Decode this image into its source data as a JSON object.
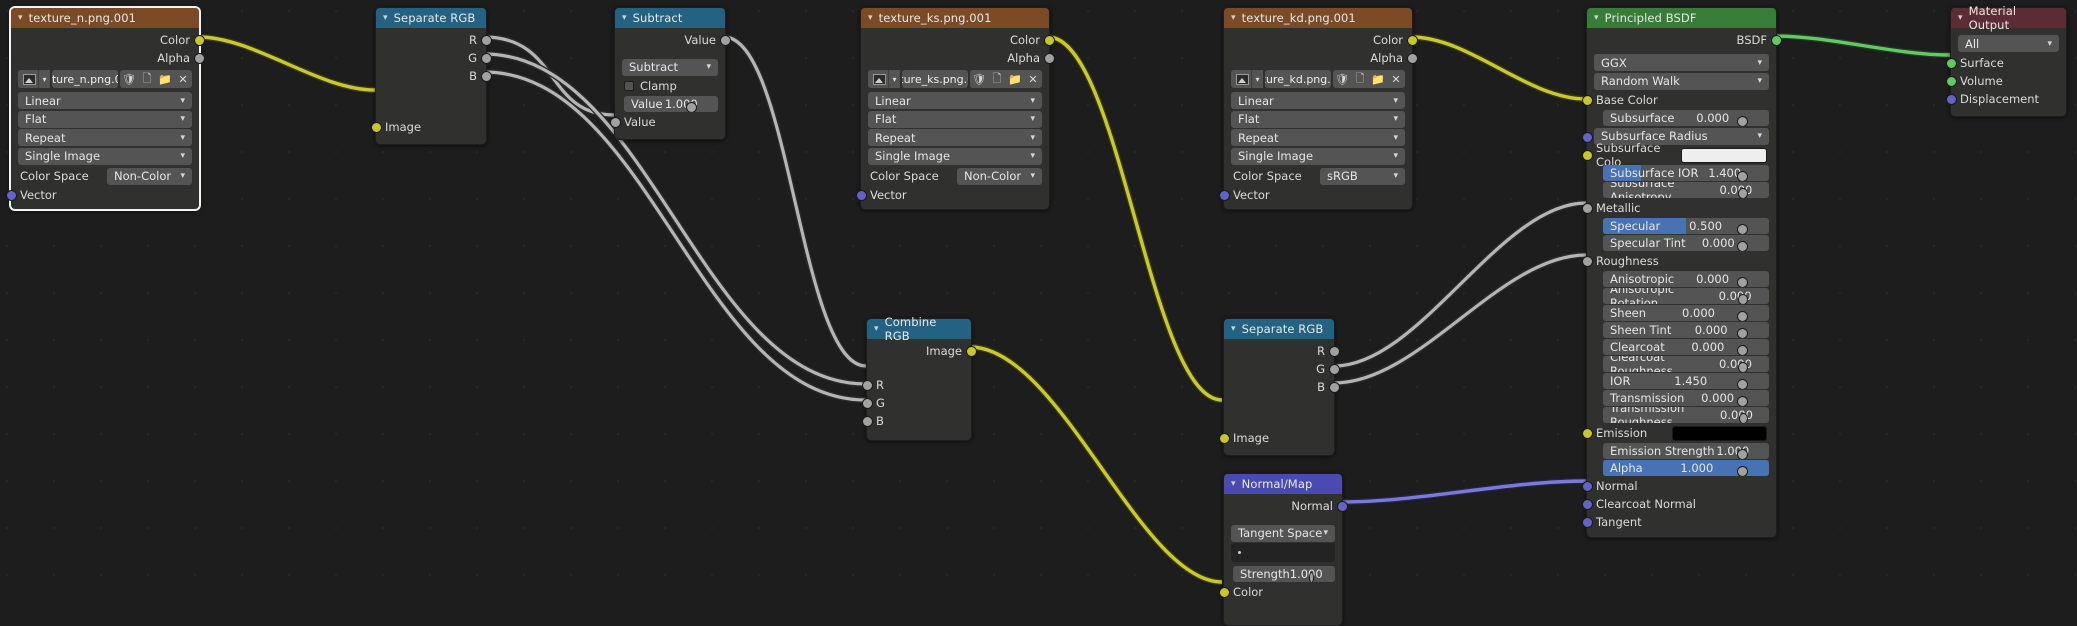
{
  "app": {
    "editor": "Blender Shader Node Editor",
    "background": "#1d1d1d"
  },
  "colors": {
    "header_texture": "#7c4b26",
    "header_converter": "#246283",
    "header_shader": "#377d37",
    "header_output": "#5b2c34",
    "header_vector": "#4a4ab0",
    "socket_color": "#c7c729",
    "socket_vector": "#6363c7",
    "socket_shader": "#63c763",
    "socket_value": "#a1a1a1",
    "slider_fill": "#4772b3",
    "node_body": "#30302f",
    "widget": "#545454"
  },
  "nodes": [
    {
      "id": "texture_n",
      "title": "texture_n.png.001",
      "type": "image-texture",
      "selected": true,
      "outputs": [
        {
          "name": "Color",
          "socket": "yellow"
        },
        {
          "name": "Alpha",
          "socket": "grey"
        }
      ],
      "datablock": {
        "name": "texture_n.png.001",
        "buttons": [
          "shield-icon",
          "copy-icon",
          "folder-icon",
          "close-icon"
        ]
      },
      "dropdowns": [
        "Linear",
        "Flat",
        "Repeat",
        "Single Image"
      ],
      "color_space": {
        "label": "Color Space",
        "value": "Non-Color"
      },
      "inputs": [
        {
          "name": "Vector",
          "socket": "purple"
        }
      ]
    },
    {
      "id": "separate_rgb_1",
      "title": "Separate RGB",
      "type": "converter",
      "outputs": [
        {
          "name": "R",
          "socket": "grey"
        },
        {
          "name": "G",
          "socket": "grey"
        },
        {
          "name": "B",
          "socket": "grey"
        }
      ],
      "inputs": [
        {
          "name": "Image",
          "socket": "yellow"
        }
      ]
    },
    {
      "id": "subtract",
      "title": "Subtract",
      "type": "converter",
      "outputs": [
        {
          "name": "Value",
          "socket": "grey"
        }
      ],
      "operation": "Subtract",
      "clamp": {
        "label": "Clamp",
        "checked": false
      },
      "value_field": {
        "label": "Value",
        "value": "1.000"
      },
      "inputs": [
        {
          "name": "Value",
          "socket": "grey"
        }
      ]
    },
    {
      "id": "texture_ks",
      "title": "texture_ks.png.001",
      "type": "image-texture",
      "outputs": [
        {
          "name": "Color",
          "socket": "yellow"
        },
        {
          "name": "Alpha",
          "socket": "grey"
        }
      ],
      "datablock": {
        "name": "texture_ks.png.001",
        "buttons": [
          "shield-icon",
          "copy-icon",
          "folder-icon",
          "close-icon"
        ]
      },
      "dropdowns": [
        "Linear",
        "Flat",
        "Repeat",
        "Single Image"
      ],
      "color_space": {
        "label": "Color Space",
        "value": "Non-Color"
      },
      "inputs": [
        {
          "name": "Vector",
          "socket": "purple"
        }
      ]
    },
    {
      "id": "texture_kd",
      "title": "texture_kd.png.001",
      "type": "image-texture",
      "outputs": [
        {
          "name": "Color",
          "socket": "yellow"
        },
        {
          "name": "Alpha",
          "socket": "grey"
        }
      ],
      "datablock": {
        "name": "texture_kd.png.001",
        "buttons": [
          "shield-icon",
          "copy-icon",
          "folder-icon",
          "close-icon"
        ]
      },
      "dropdowns": [
        "Linear",
        "Flat",
        "Repeat",
        "Single Image"
      ],
      "color_space": {
        "label": "Color Space",
        "value": "sRGB"
      },
      "inputs": [
        {
          "name": "Vector",
          "socket": "purple"
        }
      ]
    },
    {
      "id": "combine_rgb",
      "title": "Combine RGB",
      "type": "converter",
      "outputs": [
        {
          "name": "Image",
          "socket": "yellow"
        }
      ],
      "inputs": [
        {
          "name": "R",
          "socket": "grey"
        },
        {
          "name": "G",
          "socket": "grey"
        },
        {
          "name": "B",
          "socket": "grey"
        }
      ]
    },
    {
      "id": "separate_rgb_2",
      "title": "Separate RGB",
      "type": "converter",
      "outputs": [
        {
          "name": "R",
          "socket": "grey"
        },
        {
          "name": "G",
          "socket": "grey"
        },
        {
          "name": "B",
          "socket": "grey"
        }
      ],
      "inputs": [
        {
          "name": "Image",
          "socket": "yellow"
        }
      ]
    },
    {
      "id": "normal_map",
      "title": "Normal/Map",
      "type": "vector",
      "outputs": [
        {
          "name": "Normal",
          "socket": "purple"
        }
      ],
      "space": "Tangent Space",
      "uv_field": "",
      "strength": {
        "label": "Strength",
        "value": "1.000"
      },
      "inputs": [
        {
          "name": "Color",
          "socket": "yellow"
        }
      ]
    },
    {
      "id": "principled",
      "title": "Principled BSDF",
      "type": "shader",
      "outputs": [
        {
          "name": "BSDF",
          "socket": "green"
        }
      ],
      "distribution": "GGX",
      "subsurface_method": "Random Walk",
      "properties": [
        {
          "name": "Base Color",
          "kind": "socket-label",
          "socket": "yellow"
        },
        {
          "name": "Subsurface",
          "kind": "slider",
          "value": "0.000",
          "fill": 0
        },
        {
          "name": "Subsurface Radius",
          "kind": "dropdown",
          "socket": "purple"
        },
        {
          "name": "Subsurface Colo",
          "kind": "color",
          "swatch": "#eeeeee",
          "socket": "yellow"
        },
        {
          "name": "Subsurface IOR",
          "kind": "slider",
          "value": "1.400",
          "fill": 23
        },
        {
          "name": "Subsurface Anisotropy",
          "kind": "slider",
          "value": "0.000",
          "fill": 0
        },
        {
          "name": "Metallic",
          "kind": "socket-label",
          "socket": "grey"
        },
        {
          "name": "Specular",
          "kind": "slider",
          "value": "0.500",
          "fill": 50
        },
        {
          "name": "Specular Tint",
          "kind": "slider",
          "value": "0.000",
          "fill": 0
        },
        {
          "name": "Roughness",
          "kind": "socket-label",
          "socket": "grey"
        },
        {
          "name": "Anisotropic",
          "kind": "slider",
          "value": "0.000",
          "fill": 0
        },
        {
          "name": "Anisotropic Rotation",
          "kind": "slider",
          "value": "0.000",
          "fill": 0
        },
        {
          "name": "Sheen",
          "kind": "slider",
          "value": "0.000",
          "fill": 0
        },
        {
          "name": "Sheen Tint",
          "kind": "slider",
          "value": "0.000",
          "fill": 0
        },
        {
          "name": "Clearcoat",
          "kind": "slider",
          "value": "0.000",
          "fill": 0
        },
        {
          "name": "Clearcoat Roughness",
          "kind": "slider",
          "value": "0.000",
          "fill": 0
        },
        {
          "name": "IOR",
          "kind": "slider",
          "value": "1.450",
          "fill": 0
        },
        {
          "name": "Transmission",
          "kind": "slider",
          "value": "0.000",
          "fill": 0
        },
        {
          "name": "Transmission Roughness",
          "kind": "slider",
          "value": "0.000",
          "fill": 0
        },
        {
          "name": "Emission",
          "kind": "color",
          "swatch": "#000000",
          "socket": "yellow"
        },
        {
          "name": "Emission Strength",
          "kind": "slider",
          "value": "1.000",
          "fill": 0
        },
        {
          "name": "Alpha",
          "kind": "slider",
          "value": "1.000",
          "fill": 100
        },
        {
          "name": "Normal",
          "kind": "socket-label",
          "socket": "purple"
        },
        {
          "name": "Clearcoat Normal",
          "kind": "socket-label",
          "socket": "purple"
        },
        {
          "name": "Tangent",
          "kind": "socket-label",
          "socket": "purple"
        }
      ]
    },
    {
      "id": "material_output",
      "title": "Material Output",
      "type": "output",
      "target": "All",
      "inputs": [
        {
          "name": "Surface",
          "socket": "green"
        },
        {
          "name": "Volume",
          "socket": "green"
        },
        {
          "name": "Displacement",
          "socket": "purple"
        }
      ]
    }
  ],
  "links": [
    {
      "from": "texture_n.Color",
      "to": "separate_rgb_1.Image",
      "color": "#c7c729"
    },
    {
      "from": "separate_rgb_1.R",
      "to": "subtract.Value",
      "color": "#b5b5b5"
    },
    {
      "from": "separate_rgb_1.G",
      "to": "combine_rgb.G",
      "color": "#b5b5b5"
    },
    {
      "from": "separate_rgb_1.B",
      "to": "combine_rgb.B",
      "color": "#b5b5b5"
    },
    {
      "from": "subtract.Value",
      "to": "combine_rgb.R",
      "color": "#b5b5b5"
    },
    {
      "from": "texture_ks.Color",
      "to": "separate_rgb_2.Image",
      "color": "#c7c729"
    },
    {
      "from": "texture_kd.Color",
      "to": "principled.Base Color",
      "color": "#c7c729"
    },
    {
      "from": "combine_rgb.Image",
      "to": "normal_map.Color",
      "color": "#c7c729"
    },
    {
      "from": "separate_rgb_2.G",
      "to": "principled.Metallic",
      "color": "#b5b5b5"
    },
    {
      "from": "separate_rgb_2.B",
      "to": "principled.Roughness",
      "color": "#b5b5b5"
    },
    {
      "from": "normal_map.Normal",
      "to": "principled.Normal",
      "color": "#7b7bd6"
    },
    {
      "from": "principled.BSDF",
      "to": "material_output.Surface",
      "color": "#63c763"
    }
  ]
}
